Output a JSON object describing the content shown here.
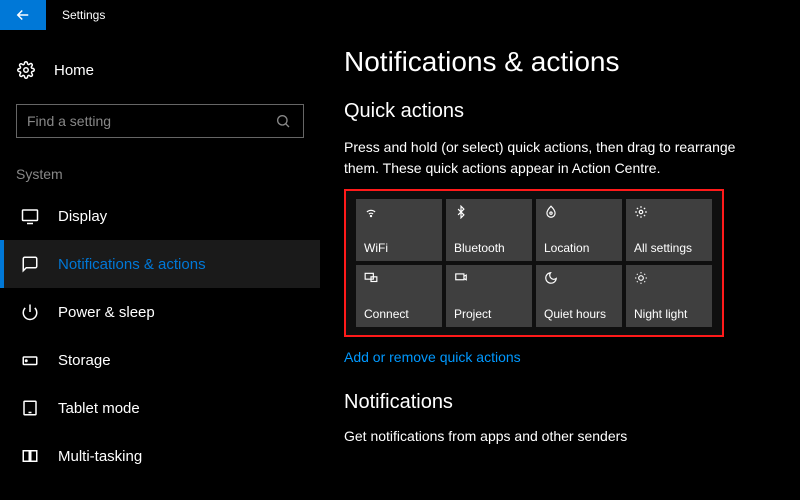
{
  "titlebar": {
    "title": "Settings"
  },
  "sidebar": {
    "home_label": "Home",
    "search_placeholder": "Find a setting",
    "section_label": "System",
    "items": [
      {
        "label": "Display"
      },
      {
        "label": "Notifications & actions"
      },
      {
        "label": "Power & sleep"
      },
      {
        "label": "Storage"
      },
      {
        "label": "Tablet mode"
      },
      {
        "label": "Multi-tasking"
      }
    ]
  },
  "main": {
    "title": "Notifications & actions",
    "quick_actions": {
      "heading": "Quick actions",
      "description": "Press and hold (or select) quick actions, then drag to rearrange them. These quick actions appear in Action Centre.",
      "tiles": [
        {
          "label": "WiFi"
        },
        {
          "label": "Bluetooth"
        },
        {
          "label": "Location"
        },
        {
          "label": "All settings"
        },
        {
          "label": "Connect"
        },
        {
          "label": "Project"
        },
        {
          "label": "Quiet hours"
        },
        {
          "label": "Night light"
        }
      ],
      "link": "Add or remove quick actions"
    },
    "notifications": {
      "heading": "Notifications",
      "description": "Get notifications from apps and other senders"
    }
  }
}
